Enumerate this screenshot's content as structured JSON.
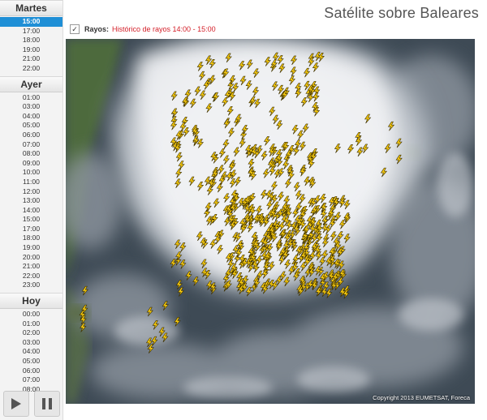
{
  "title": "Satélite sobre Baleares",
  "layer": {
    "checkbox_mark": "✓",
    "name": "Rayos:",
    "description": "Histórico de rayos 14:00 - 15:00"
  },
  "days": [
    {
      "label": "Martes",
      "times": [
        "15:00",
        "17:00",
        "18:00",
        "19:00",
        "21:00",
        "22:00"
      ],
      "active_index": 0
    },
    {
      "label": "Ayer",
      "times": [
        "01:00",
        "03:00",
        "04:00",
        "05:00",
        "06:00",
        "07:00",
        "08:00",
        "09:00",
        "10:00",
        "11:00",
        "12:00",
        "13:00",
        "14:00",
        "15:00",
        "17:00",
        "18:00",
        "19:00",
        "20:00",
        "21:00",
        "22:00",
        "23:00"
      ]
    },
    {
      "label": "Hoy",
      "times": [
        "00:00",
        "01:00",
        "02:00",
        "03:00",
        "04:00",
        "05:00",
        "06:00",
        "07:00",
        "08:00"
      ]
    }
  ],
  "controls": {
    "play_icon": "play-icon",
    "pause_icon": "pause-icon"
  },
  "map": {
    "copyright": "Copyright 2013 EUMETSAT, Foreca"
  },
  "colors": {
    "active_time": "#1f8fd6",
    "layer_desc": "#d4202a",
    "lightning": "#f6c90e"
  }
}
